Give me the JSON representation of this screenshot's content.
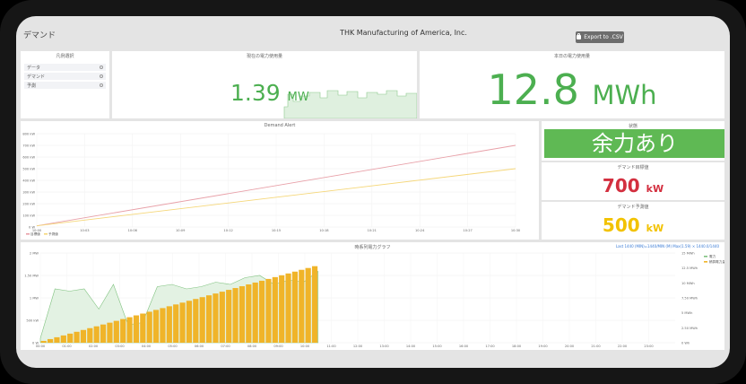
{
  "header": {
    "dashboard_title": "デマンド",
    "company": "THK Manufacturing of America, Inc.",
    "export_label": "Export to .CSV"
  },
  "legend_panel": {
    "title": "凡例選択",
    "items": [
      {
        "label": "データ"
      },
      {
        "label": "デマンド"
      },
      {
        "label": "予測"
      }
    ]
  },
  "current_power": {
    "title": "現在の電力使用量",
    "value": "1.39",
    "unit": "MW"
  },
  "today_energy": {
    "title": "本日の電力使用量",
    "value": "12.8",
    "unit": "MWh"
  },
  "status_panel": {
    "title": "状態",
    "status_text": "余力あり"
  },
  "demand_target": {
    "title": "デマンド目標値",
    "value": "700",
    "unit": "kW"
  },
  "demand_forecast": {
    "title": "デマンド予測値",
    "value": "500",
    "unit": "kW"
  },
  "colors": {
    "green": "#4caf50",
    "red": "#d32f3f",
    "yellow": "#f2c200",
    "status_green": "#5fb954",
    "bar_orange": "#f0b429"
  },
  "chart_data": [
    {
      "type": "line",
      "title": "Demand Alert",
      "x": [
        "10:00",
        "10:03",
        "10:06",
        "10:09",
        "10:12",
        "10:15",
        "10:18",
        "10:21",
        "10:24",
        "10:27",
        "10:30"
      ],
      "y_ticks": [
        "0 W",
        "100 kW",
        "200 kW",
        "300 kW",
        "400 kW",
        "500 kW",
        "600 kW",
        "700 kW",
        "800 kW"
      ],
      "ylim": [
        0,
        800
      ],
      "series": [
        {
          "name": "目標値",
          "color": "#e8a0a8",
          "points": [
            [
              0,
              10
            ],
            [
              10,
              700
            ]
          ]
        },
        {
          "name": "予測値",
          "color": "#f5d77a",
          "points": [
            [
              0,
              10
            ],
            [
              10,
              500
            ]
          ]
        }
      ],
      "legend_position": "bottom-left",
      "grid": true
    },
    {
      "type": "bar",
      "title": "時系列電力グラフ",
      "note": "Last 1440 (MIN)=1440/MIN (M) Max(1.59) × 1440.0/1440",
      "x_ticks": [
        "00:00",
        "01:00",
        "02:00",
        "03:00",
        "04:00",
        "05:00",
        "06:00",
        "07:00",
        "08:00",
        "09:00",
        "10:00",
        "11:00",
        "12:00",
        "13:00",
        "14:00",
        "15:00",
        "16:00",
        "17:00",
        "18:00",
        "19:00",
        "20:00",
        "21:00",
        "22:00",
        "23:00"
      ],
      "y_left_ticks": [
        "0 W",
        "500 kW",
        "1 MW",
        "1.50 MW",
        "2 MW"
      ],
      "y_left_lim": [
        0,
        2
      ],
      "y_right_ticks": [
        "0 Wh",
        "2.50 MWh",
        "5 MWh",
        "7.50 MWh",
        "10 MWh",
        "12.5 MWh",
        "15 MWh"
      ],
      "y_right_lim": [
        0,
        15
      ],
      "series": [
        {
          "name": "電力",
          "axis": "left",
          "color": "#7fc27f"
        },
        {
          "name": "積算電力量",
          "axis": "right",
          "color": "#f0b429"
        }
      ],
      "bar_hours_fraction": 10.5,
      "bar_final_value": 12.8,
      "power_levels": [
        0.1,
        1.2,
        1.15,
        1.2,
        0.75,
        1.3,
        0.4,
        0.45,
        1.25,
        1.3,
        1.2,
        1.25,
        1.35,
        1.3,
        1.45,
        1.5,
        1.3,
        1.4,
        1.35,
        1.59
      ],
      "legend_position": "top-right",
      "grid": true
    }
  ]
}
